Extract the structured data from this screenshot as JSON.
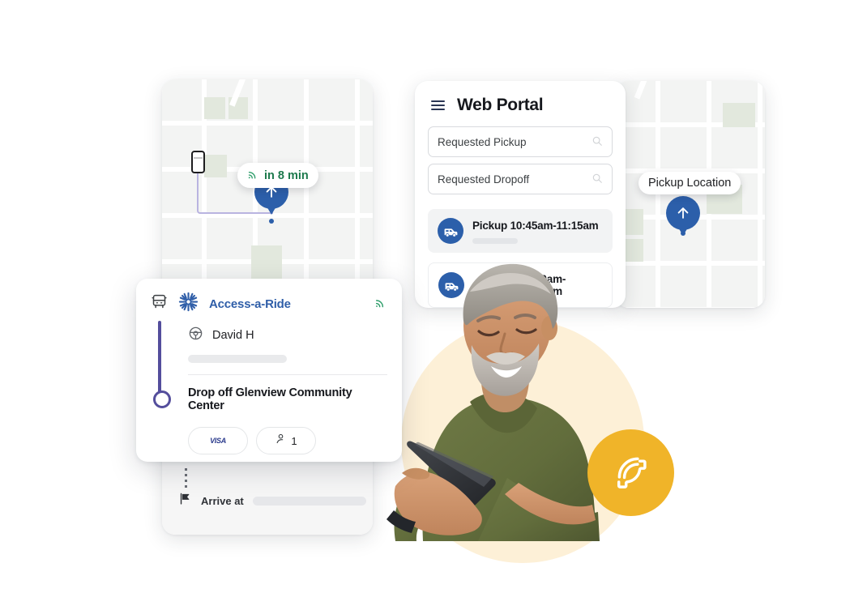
{
  "page": {
    "background": "#ffffff",
    "accent_blue": "#2c5faa",
    "accent_purple": "#544e9c",
    "accent_yellow": "#f0b429",
    "accent_green": "#1d7a4d",
    "beige_circle": "#fdf0d7"
  },
  "left_map_card": {
    "name": "Vehicle tracking map",
    "eta_chip": {
      "icon": "signal-icon",
      "label": "in 8 min"
    },
    "pin_icon": "arrow-up-pin-icon",
    "vehicle_icon": "vehicle-marker-icon"
  },
  "right_map_card": {
    "name": "Pickup location map",
    "location_chip": {
      "label": "Pickup Location"
    },
    "pin_icon": "arrow-up-pin-icon"
  },
  "portal": {
    "menu_icon": "hamburger-menu-icon",
    "title": "Web Portal",
    "fields": [
      {
        "value": "Requested Pickup",
        "placeholder": "Requested Pickup",
        "icon": "search-icon"
      },
      {
        "value": "Requested Dropoff",
        "placeholder": "Requested Dropoff",
        "icon": "search-icon"
      }
    ],
    "trips": [
      {
        "icon": "van-icon",
        "title": "Pickup 10:45am-11:15am",
        "selected": true
      },
      {
        "icon": "van-icon",
        "title": "11:00am-11:30am",
        "selected": false
      }
    ]
  },
  "ride_card": {
    "vehicle_icon": "bus-front-icon",
    "logo_icon": "sunburst-logo-icon",
    "brand": "Access-a-Ride",
    "signal_icon": "signal-icon",
    "driver": {
      "icon": "steering-wheel-icon",
      "name": "David H"
    },
    "dropoff": "Drop off Glenview Community Center",
    "payment": {
      "icon": "visa-card-icon",
      "label": "VISA"
    },
    "passengers": {
      "icon": "person-icon",
      "count": "1"
    }
  },
  "arrive_strip": {
    "icon": "flag-icon",
    "label": "Arrive at"
  },
  "call_fab": {
    "icon": "phone-call-icon",
    "label": "Call"
  },
  "photo": {
    "alt": "Smiling older man with gray beard in olive shirt using a smartphone"
  }
}
